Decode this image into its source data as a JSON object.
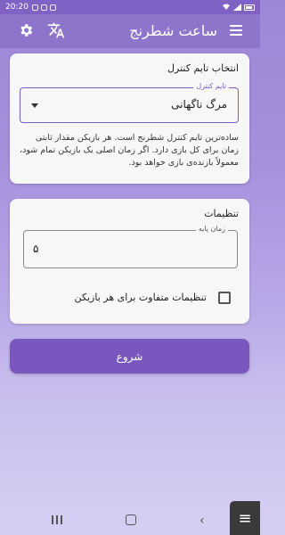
{
  "status_bar": {
    "time": "20:20"
  },
  "app_bar": {
    "title": "ساعت شطرنج",
    "settings_icon": "gear-icon",
    "translate_icon": "translate-icon",
    "menu_icon": "hamburger-menu-icon"
  },
  "control_section": {
    "title": "انتخاب تایم کنترل",
    "dropdown_label": "تایم کنترل",
    "dropdown_value": "مرگ ناگهانی",
    "description": "ساده‌ترین تایم کنترل شطرنج است. هر بازیکن مقدار ثابتی زمان برای کل بازی دارد. اگر زمان اصلی یک بازیکن تمام شود، معمولاً بازنده‌ی بازی خواهد بود."
  },
  "settings_section": {
    "title": "تنظیمات",
    "base_time_label": "زمان پایه",
    "base_time_value": "۵",
    "different_settings_label": "تنظیمات متفاوت برای هر بازیکن"
  },
  "start_button": {
    "label": "شروع"
  }
}
